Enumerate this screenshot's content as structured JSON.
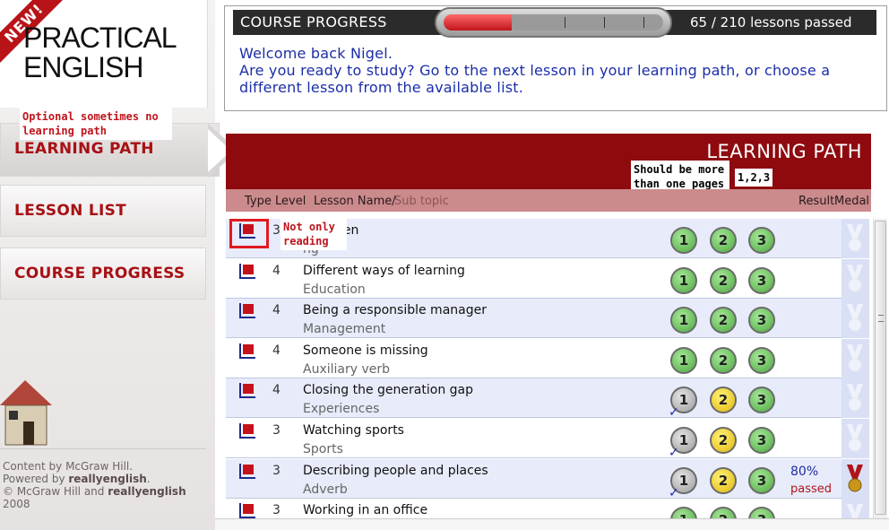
{
  "logo": {
    "badge": "NEW!",
    "line1": "PRACTICAL",
    "line2": "ENGLISH"
  },
  "notes": {
    "learning_path": "Optional sometimes no learning path",
    "pages": "Should be more than one pages",
    "pages_numbers": "1,2,3",
    "not_only": "Not only reading"
  },
  "nav": {
    "learning_path": "LEARNING PATH",
    "lesson_list": "LESSON LIST",
    "course_progress": "COURSE PROGRESS"
  },
  "footer": {
    "line1": "Content by McGraw Hill.",
    "line2_prefix": "Powered by ",
    "line2_brand": "reallyenglish",
    "line2_suffix": ".",
    "line3_prefix": "© McGraw Hill and ",
    "line3_brand": "reallyenglish",
    "line4": "2008"
  },
  "progress": {
    "title": "COURSE PROGRESS",
    "passed": 65,
    "total": 210,
    "label": "65 / 210 lessons passed"
  },
  "welcome": {
    "greeting": "Welcome back Nigel.",
    "message": "Are you ready to study? Go to the next lesson in your learning path, or choose a different lesson from the available list."
  },
  "learning_path": {
    "title": "LEARNING PATH",
    "columns": {
      "type": "Type",
      "level": "Level",
      "lesson": "Lesson Name/",
      "subtopic": "Sub topic",
      "result": "Result",
      "medal": "Medal"
    },
    "rows": [
      {
        "level": "3",
        "name": "a garden",
        "sub": "ng",
        "stages": [
          "green",
          "green",
          "green"
        ],
        "checks": [
          false,
          false,
          false
        ]
      },
      {
        "level": "4",
        "name": "Different ways of learning",
        "sub": "Education",
        "stages": [
          "green",
          "green",
          "green"
        ],
        "checks": [
          false,
          false,
          false
        ]
      },
      {
        "level": "4",
        "name": "Being a responsible manager",
        "sub": "Management",
        "stages": [
          "green",
          "green",
          "green"
        ],
        "checks": [
          false,
          false,
          false
        ]
      },
      {
        "level": "4",
        "name": "Someone is missing",
        "sub": "Auxiliary verb",
        "stages": [
          "green",
          "green",
          "green"
        ],
        "checks": [
          false,
          false,
          false
        ]
      },
      {
        "level": "4",
        "name": "Closing the generation gap",
        "sub": "Experiences",
        "stages": [
          "grey",
          "yellow",
          "green"
        ],
        "checks": [
          true,
          false,
          false
        ]
      },
      {
        "level": "3",
        "name": "Watching sports",
        "sub": "Sports",
        "stages": [
          "grey",
          "yellow",
          "green"
        ],
        "checks": [
          true,
          false,
          false
        ]
      },
      {
        "level": "3",
        "name": "Describing people and places",
        "sub": "Adverb",
        "stages": [
          "grey",
          "yellow",
          "green"
        ],
        "checks": [
          true,
          false,
          false
        ],
        "result": "80%",
        "result_status": "passed",
        "medal": true
      },
      {
        "level": "3",
        "name": "Working in an office",
        "sub": "",
        "stages": [
          "green",
          "green",
          "green"
        ],
        "checks": [
          false,
          false,
          false
        ]
      }
    ]
  },
  "colors": {
    "brand_red": "#8e0a0f",
    "nav_text": "#a81014",
    "welcome_text": "#1b2ea8"
  }
}
